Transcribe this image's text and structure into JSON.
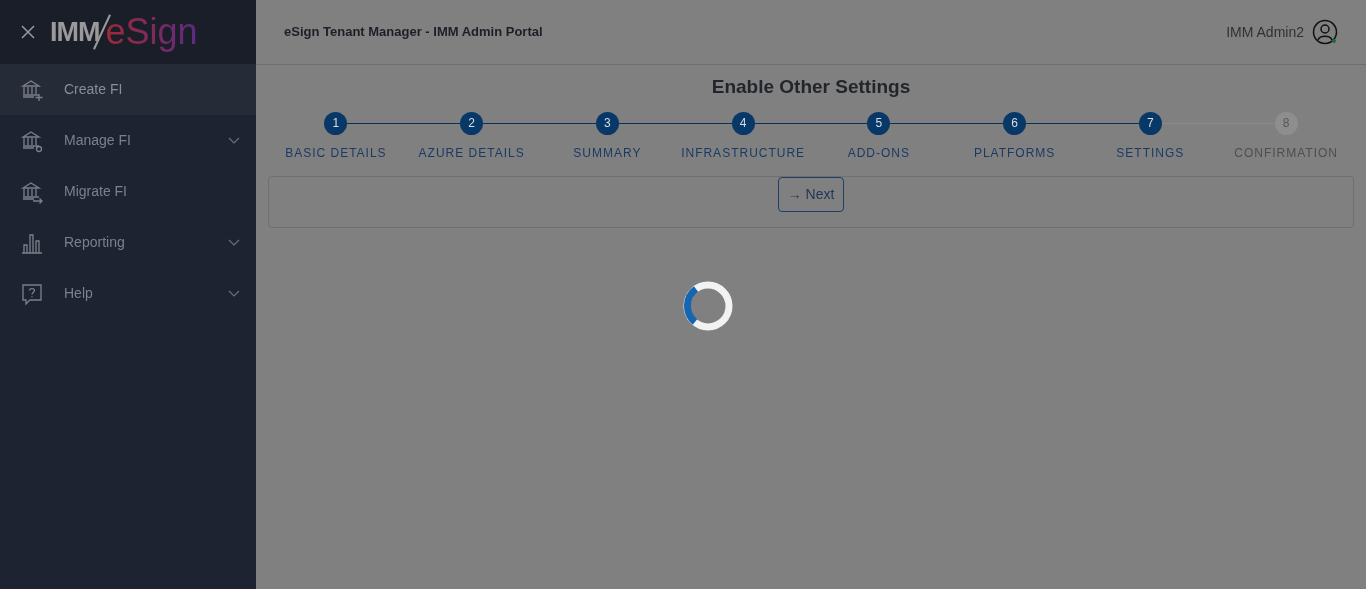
{
  "sidebar": {
    "logo": {
      "left": "IMM",
      "right": "eSign"
    },
    "items": [
      {
        "label": "Create FI",
        "selected": true,
        "kind": "link"
      },
      {
        "label": "Manage FI",
        "selected": false,
        "kind": "group"
      },
      {
        "label": "Migrate FI",
        "selected": false,
        "kind": "link"
      },
      {
        "label": "Reporting",
        "selected": false,
        "kind": "group"
      },
      {
        "label": "Help",
        "selected": false,
        "kind": "group"
      }
    ]
  },
  "header": {
    "title": "eSign Tenant Manager - IMM Admin Portal",
    "user": "IMM Admin2"
  },
  "page": {
    "title": "Enable Other Settings",
    "steps": [
      {
        "number": "1",
        "label": "BASIC DETAILS",
        "completed": true
      },
      {
        "number": "2",
        "label": "AZURE DETAILS",
        "completed": true
      },
      {
        "number": "3",
        "label": "SUMMARY",
        "completed": true
      },
      {
        "number": "4",
        "label": "INFRASTRUCTURE",
        "completed": true
      },
      {
        "number": "5",
        "label": "ADD-ONS",
        "completed": true
      },
      {
        "number": "6",
        "label": "PLATFORMS",
        "completed": true
      },
      {
        "number": "7",
        "label": "SETTINGS",
        "completed": true
      },
      {
        "number": "8",
        "label": "CONFIRMATION",
        "completed": false
      }
    ],
    "next_button": {
      "arrow": "→",
      "label": "Next"
    }
  }
}
